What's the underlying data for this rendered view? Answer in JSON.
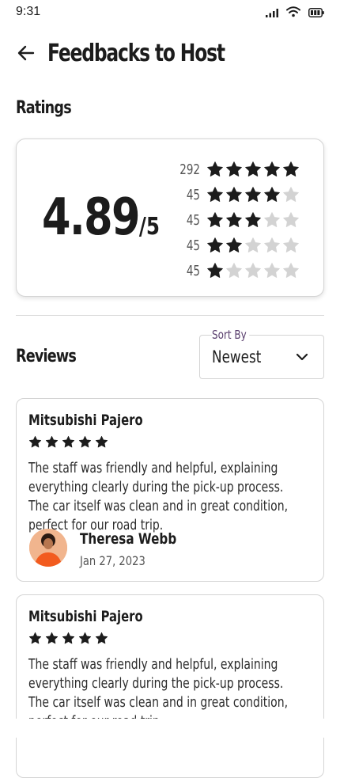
{
  "status_bar": {
    "time": "9:31",
    "icons": [
      "signal-icon",
      "wifi-icon",
      "battery-icon"
    ]
  },
  "header": {
    "back_icon": "arrow-left-icon",
    "title": "Feedbacks to Host"
  },
  "ratings": {
    "section_title": "Ratings",
    "average": "4.89",
    "out_of": "/5",
    "distribution": [
      {
        "stars": 5,
        "count": "292"
      },
      {
        "stars": 4,
        "count": "45"
      },
      {
        "stars": 3,
        "count": "45"
      },
      {
        "stars": 2,
        "count": "45"
      },
      {
        "stars": 1,
        "count": "45"
      }
    ],
    "colors": {
      "filled_star": "#1c1c1c",
      "empty_star": "#d3d3d3"
    }
  },
  "reviews": {
    "section_title": "Reviews",
    "sort": {
      "label": "Sort By",
      "value": "Newest",
      "icon": "chevron-down-icon"
    },
    "items": [
      {
        "car": "Mitsubishi Pajero",
        "rating": 5,
        "text": "The staff was friendly and helpful, explaining everything clearly during the pick-up process. The car itself was clean and in great condition, perfect for our road trip.",
        "reviewer": "Theresa Webb",
        "date": "Jan 27, 2023"
      },
      {
        "car": "Mitsubishi Pajero",
        "rating": 5,
        "text": "The staff was friendly and helpful, explaining everything clearly during the pick-up process. The car itself was clean and in great condition, perfect for our road trip."
      }
    ]
  }
}
